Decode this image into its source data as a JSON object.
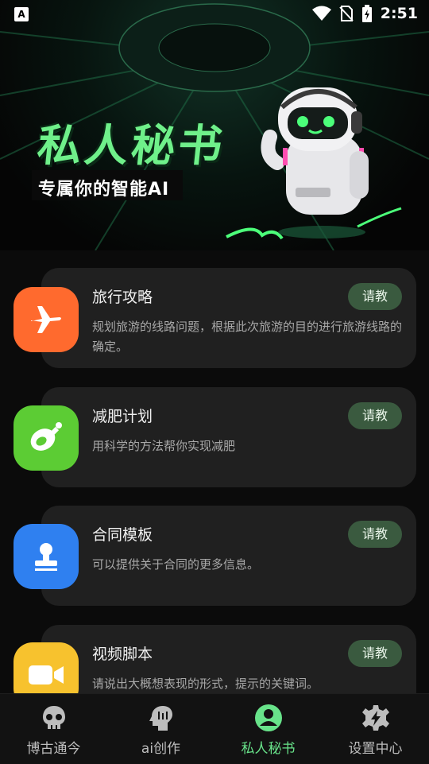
{
  "status_bar": {
    "time": "2:51",
    "app_badge": "A"
  },
  "banner": {
    "title": "私人秘书",
    "subtitle": "专属你的智能AI"
  },
  "cards": [
    {
      "title": "旅行攻略",
      "desc": "规划旅游的线路问题，根据此次旅游的目的进行旅游线路的确定。",
      "button": "请教",
      "icon": "airplane-icon",
      "color": "#ff6a2e"
    },
    {
      "title": "减肥计划",
      "desc": "用科学的方法帮你实现减肥",
      "button": "请教",
      "icon": "drumstick-icon",
      "color": "#5ccc34"
    },
    {
      "title": "合同模板",
      "desc": "可以提供关于合同的更多信息。",
      "button": "请教",
      "icon": "stamp-icon",
      "color": "#2f80f0"
    },
    {
      "title": "视频脚本",
      "desc": "请说出大概想表现的形式，提示的关键词。",
      "button": "请教",
      "icon": "video-camera-icon",
      "color": "#f7c22e"
    }
  ],
  "nav": [
    {
      "label": "博古通今",
      "icon": "skull-icon"
    },
    {
      "label": "ai创作",
      "icon": "ai-head-icon"
    },
    {
      "label": "私人秘书",
      "icon": "user-circle-icon",
      "active": true
    },
    {
      "label": "设置中心",
      "icon": "gear-bolt-icon"
    }
  ],
  "colors": {
    "accent": "#68e38a",
    "card_bg": "#202020",
    "button_bg": "#3a5a3f"
  }
}
